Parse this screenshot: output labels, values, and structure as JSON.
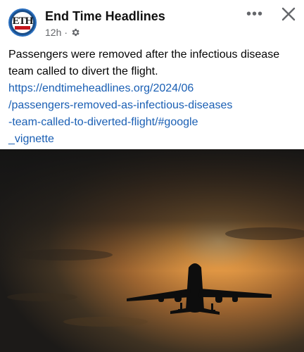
{
  "post": {
    "author": "End Time Headlines",
    "avatar_text": "ETH",
    "time": "12h",
    "separator": "·",
    "privacy_icon": "gear-icon",
    "more_icon": "more-options-icon",
    "more_label": "•••",
    "close_icon": "close-icon",
    "text": "Passengers were removed after the infectious disease team called to divert the flight.",
    "link_lines": [
      "https://endtimeheadlines.org/2024/06",
      "/passengers-removed-as-infectious-diseases",
      "-team-called-to-diverted-flight/#google",
      "_vignette"
    ],
    "image": "airplane-silhouette-sunset-photo"
  },
  "colors": {
    "link": "#1a5fb4",
    "meta": "#65676b",
    "sky_glow": "#e8a24a"
  }
}
